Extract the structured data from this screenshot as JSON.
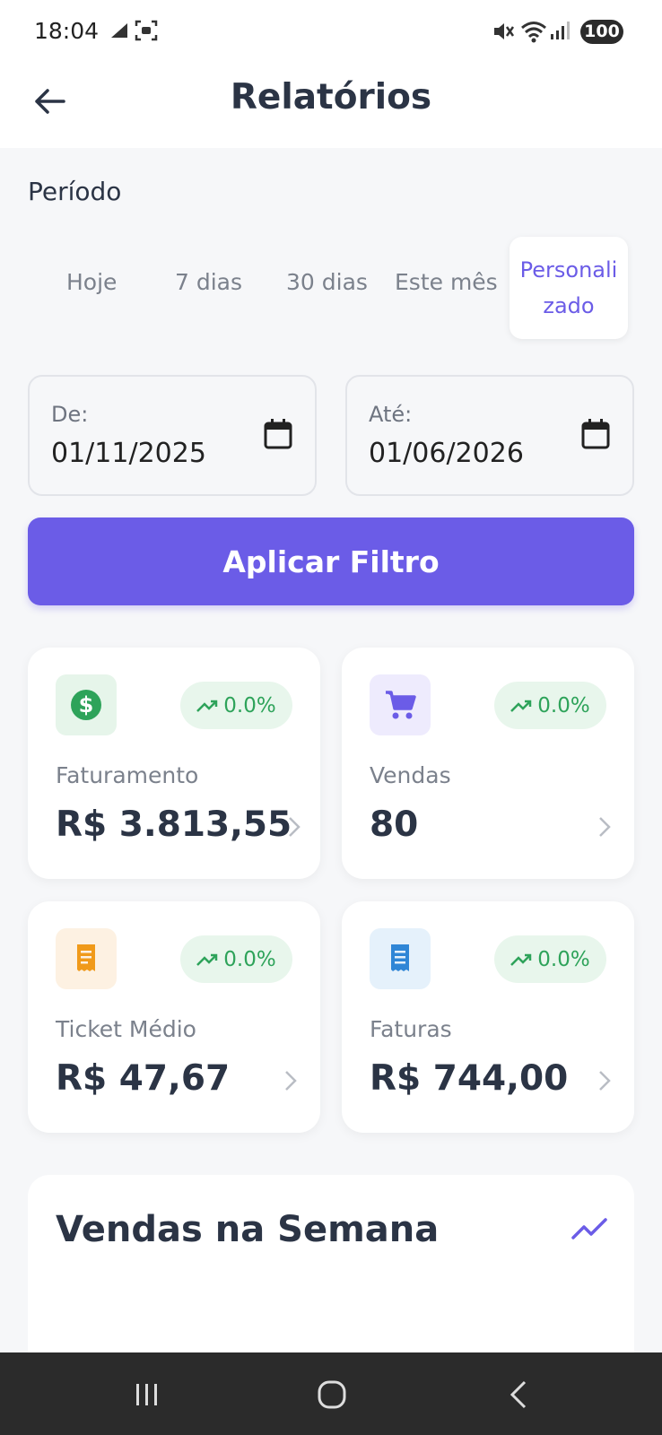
{
  "status_bar": {
    "time": "18:04",
    "battery": "100",
    "icons": [
      "signal-boost-icon",
      "screenshot-icon",
      "mute-icon",
      "wifi-icon",
      "cell-signal-icon"
    ]
  },
  "header": {
    "title": "Relatórios",
    "back_icon": "arrow-left-icon"
  },
  "period": {
    "label": "Período",
    "tabs": [
      "Hoje",
      "7 dias",
      "30 dias",
      "Este mês"
    ],
    "active_tab": "Personalizado",
    "active_line1": "Personali",
    "active_line2": "zado"
  },
  "filters": {
    "from_label": "De:",
    "from_value": "01/11/2025",
    "to_label": "Até:",
    "to_value": "01/06/2026",
    "apply_label": "Aplicar Filtro"
  },
  "cards": [
    {
      "label": "Faturamento",
      "value": "R$  3.813,55",
      "trend": "0.0%",
      "icon": "dollar-icon",
      "icon_bg": "#e6f5ea",
      "icon_color": "#2ea35a"
    },
    {
      "label": "Vendas",
      "value": "80",
      "trend": "0.0%",
      "icon": "cart-icon",
      "icon_bg": "#eeebfd",
      "icon_color": "#6b5ce7"
    },
    {
      "label": "Ticket Médio",
      "value": "R$  47,67",
      "trend": "0.0%",
      "icon": "receipt-icon",
      "icon_bg": "#fdf1e2",
      "icon_color": "#f09a1a"
    },
    {
      "label": "Faturas",
      "value": "R$  744,00",
      "trend": "0.0%",
      "icon": "invoice-icon",
      "icon_bg": "#e5f1fb",
      "icon_color": "#2f86d6"
    }
  ],
  "weekly": {
    "title": "Vendas na Semana",
    "icon": "trending-up-icon"
  },
  "colors": {
    "accent": "#6b5ce7",
    "positive": "#2ea35a",
    "text_dark": "#2b3445"
  }
}
